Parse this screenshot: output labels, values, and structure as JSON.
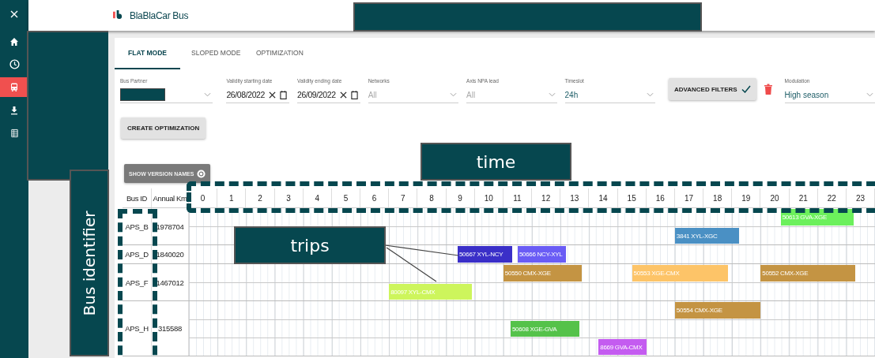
{
  "app": {
    "title": "BlaBlaCar Bus"
  },
  "sidebar": {
    "items": [
      {
        "kind": "home",
        "selected": false
      },
      {
        "kind": "clock",
        "selected": false
      },
      {
        "kind": "bus",
        "selected": true
      },
      {
        "kind": "download",
        "selected": false
      },
      {
        "kind": "table",
        "selected": false
      }
    ]
  },
  "tabs": [
    {
      "label": "FLAT MODE",
      "selected": true
    },
    {
      "label": "SLOPED MODE",
      "selected": false
    },
    {
      "label": "OPTIMIZATION",
      "selected": false
    }
  ],
  "filters": [
    {
      "kind": "select",
      "label": "Bus Partner",
      "redacted": true
    },
    {
      "kind": "date",
      "label": "Validity starting date",
      "value": "26/08/2022"
    },
    {
      "kind": "date",
      "label": "Validity ending date",
      "value": "26/09/2022"
    },
    {
      "kind": "select",
      "label": "Networks",
      "placeholder": "All"
    },
    {
      "kind": "select",
      "label": "Axis NPA lead",
      "placeholder": "All"
    },
    {
      "kind": "select",
      "label": "Timeslot",
      "value": "24h"
    },
    {
      "kind": "button",
      "label": "ADVANCED FILTERS",
      "active": true
    },
    {
      "kind": "delete"
    },
    {
      "kind": "select",
      "label": "Modulation",
      "value": "High season"
    }
  ],
  "create_button": "CREATE OPTIMIZATION",
  "version_button": "SHOW VERSION NAMES",
  "gantt": {
    "columns": [
      "Bus ID",
      "Annual Km"
    ],
    "hours": [
      "0",
      "1",
      "2",
      "3",
      "4",
      "5",
      "6",
      "7",
      "8",
      "9",
      "10",
      "11",
      "12",
      "13",
      "14",
      "15",
      "16",
      "17",
      "18",
      "19",
      "20",
      "21",
      "22",
      "23"
    ],
    "rows": [
      {
        "bus_id": "APS_B",
        "annual_km": "1978704",
        "lanes": [
          {
            "trips": [
              {
                "label": "50613 GVA-XGE",
                "color": "#6cf05c"
              }
            ]
          },
          {
            "trips": [
              {
                "label": "3841 XYL-XGC",
                "color": "#4a90c4"
              }
            ]
          }
        ]
      },
      {
        "bus_id": "APS_D",
        "annual_km": "1840020",
        "lanes": [
          {
            "trips": [
              {
                "label": "50667 XYL-NCY",
                "color": "#3a2fc8"
              },
              {
                "label": "50666 NCY-XYL",
                "color": "#6a5cf5"
              }
            ]
          }
        ]
      },
      {
        "bus_id": "APS_F",
        "annual_km": "1467012",
        "lanes": [
          {
            "trips": [
              {
                "label": "50550 CMX-XGE",
                "color": "#c49443"
              },
              {
                "label": "50553 XGE-CMX",
                "color": "#fdc468"
              },
              {
                "label": "50552 CMX-XGE",
                "color": "#c49443"
              }
            ]
          },
          {
            "trips": [
              {
                "label": "80097 XYL-CMX",
                "color": "#cdf55c"
              }
            ]
          }
        ]
      },
      {
        "bus_id": "APS_H",
        "annual_km": "315588",
        "lanes": [
          {
            "trips": [
              {
                "label": "50554 CMX-XGE",
                "color": "#c49443"
              }
            ]
          },
          {
            "trips": [
              {
                "label": "50608 XGE-GVA",
                "color": "#55c24a"
              }
            ]
          },
          {
            "trips": [
              {
                "label": "8669 GVA-CMX",
                "color": "#c45cf0"
              }
            ]
          }
        ]
      }
    ]
  },
  "annotations": [
    {
      "kind": "callout",
      "text": "time"
    },
    {
      "kind": "callout",
      "text": "trips"
    },
    {
      "kind": "vertical-callout",
      "text": "Bus identifier"
    }
  ]
}
